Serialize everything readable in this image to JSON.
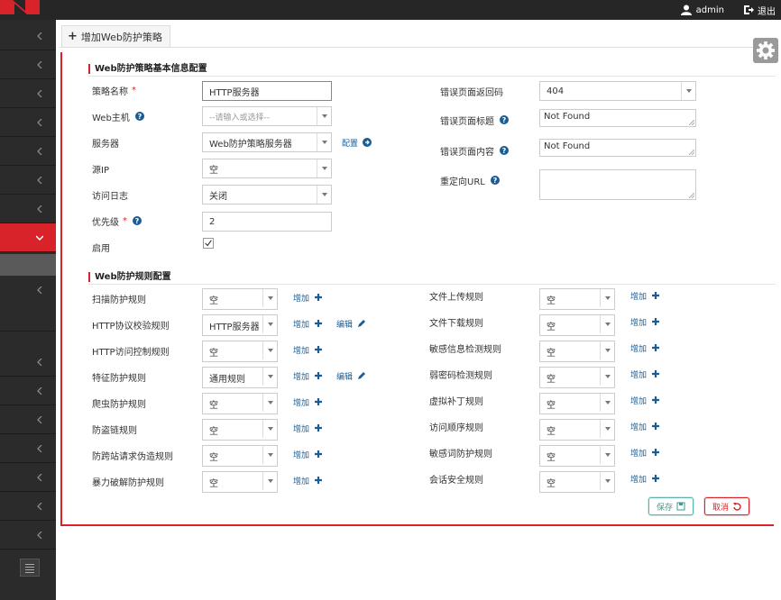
{
  "header": {
    "username": "admin",
    "logout_label": "退出"
  },
  "tab": {
    "label": "增加Web防护策略"
  },
  "basic": {
    "section_title": "Web防护策略基本信息配置",
    "left": [
      {
        "label": "策略名称",
        "required": "*",
        "value": "HTTP服务器",
        "type": "text"
      },
      {
        "label": "Web主机",
        "help": true,
        "placeholder": "--请输入或选择--",
        "type": "combo"
      },
      {
        "label": "服务器",
        "value": "Web防护策略服务器",
        "type": "select",
        "link": "配置"
      },
      {
        "label": "源IP",
        "value": "空",
        "type": "select"
      },
      {
        "label": "访问日志",
        "value": "关闭",
        "type": "select"
      },
      {
        "label": "优先级",
        "required": "*",
        "help": true,
        "value": "2",
        "type": "text"
      },
      {
        "label": "启用",
        "type": "checkbox",
        "checked": true
      }
    ],
    "right": [
      {
        "label": "错误页面返回码",
        "value": "404",
        "type": "select"
      },
      {
        "label": "错误页面标题",
        "help": true,
        "value": "Not Found",
        "type": "textarea"
      },
      {
        "label": "错误页面内容",
        "help": true,
        "value": "Not Found",
        "type": "textarea"
      },
      {
        "label": "重定向URL",
        "help": true,
        "value": "",
        "type": "textarea"
      }
    ]
  },
  "rules": {
    "section_title": "Web防护规则配置",
    "add_label": "增加",
    "edit_label": "编辑",
    "left": [
      {
        "label": "扫描防护规则",
        "value": "空",
        "edit": false
      },
      {
        "label": "HTTP协议校验规则",
        "value": "HTTP服务器",
        "edit": true
      },
      {
        "label": "HTTP访问控制规则",
        "value": "空",
        "edit": false
      },
      {
        "label": "特征防护规则",
        "value": "通用规则",
        "edit": true
      },
      {
        "label": "爬虫防护规则",
        "value": "空",
        "edit": false
      },
      {
        "label": "防盗链规则",
        "value": "空",
        "edit": false
      },
      {
        "label": "防跨站请求伪造规则",
        "value": "空",
        "edit": false
      },
      {
        "label": "暴力破解防护规则",
        "value": "空",
        "edit": false
      }
    ],
    "right": [
      {
        "label": "文件上传规则",
        "value": "空"
      },
      {
        "label": "文件下载规则",
        "value": "空"
      },
      {
        "label": "敏感信息检测规则",
        "value": "空"
      },
      {
        "label": "弱密码检测规则",
        "value": "空"
      },
      {
        "label": "虚拟补丁规则",
        "value": "空"
      },
      {
        "label": "访问顺序规则",
        "value": "空"
      },
      {
        "label": "敏感词防护规则",
        "value": "空"
      },
      {
        "label": "会话安全规则",
        "value": "空"
      }
    ]
  },
  "buttons": {
    "save_label": "保存",
    "cancel_label": "取消"
  },
  "colors": {
    "accent": "#d9232a",
    "link": "#1a5c93",
    "save": "#3d9a94"
  }
}
